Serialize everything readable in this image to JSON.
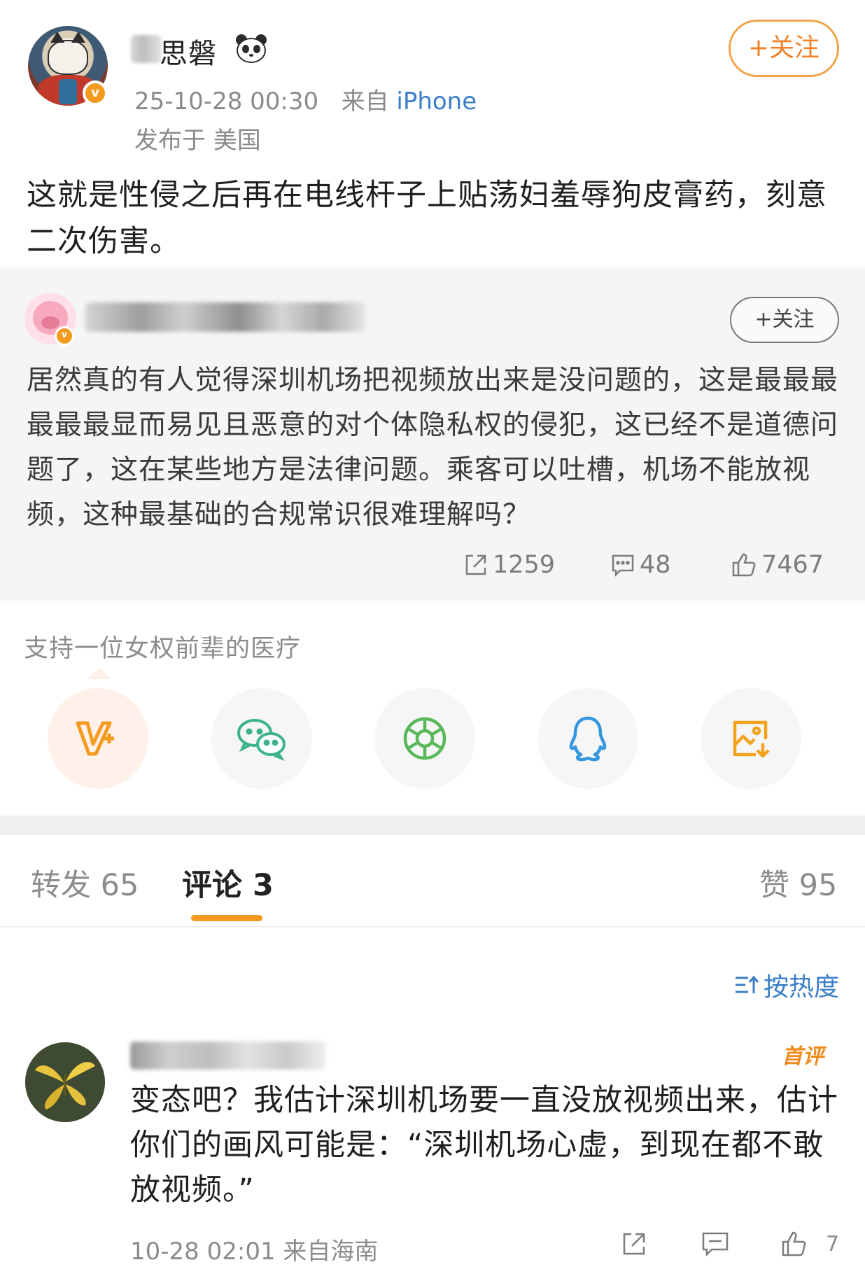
{
  "post": {
    "author_name": "思磐",
    "timestamp": "25-10-28 00:30",
    "source_prefix": "来自",
    "device": "iPhone",
    "location": "发布于 美国",
    "follow_label": "+关注",
    "text": "这就是性侵之后再在电线杆子上贴荡妇羞辱狗皮膏药，刻意二次伤害。"
  },
  "quoted": {
    "follow_label": "+关注",
    "text": "居然真的有人觉得深圳机场把视频放出来是没问题的，这是最最最最最最显而易见且恶意的对个体隐私权的侵犯，这已经不是道德问题了，这在某些地方是法律问题。乘客可以吐槽，机场不能放视频，这种最基础的合规常识很难理解吗？",
    "reposts": "1259",
    "comments": "48",
    "likes": "7467"
  },
  "share": {
    "title": "支持一位女权前辈的医疗",
    "items": [
      {
        "icon": "vip-icon"
      },
      {
        "icon": "wechat-icon"
      },
      {
        "icon": "moments-icon"
      },
      {
        "icon": "qq-icon"
      },
      {
        "icon": "save-image-icon"
      }
    ]
  },
  "tabs": {
    "repost": "转发 65",
    "comment": "评论 3",
    "like": "赞 95",
    "active": "comment"
  },
  "sort": {
    "label": "按热度"
  },
  "comment": {
    "badge": "首评",
    "text": "变态吧？我估计深圳机场要一直没放视频出来，估计你们的画风可能是：“深圳机场心虚，到现在都不敢放视频。”",
    "meta": "10-28 02:01 来自海南",
    "likes": "7"
  },
  "colors": {
    "accent_orange": "#f39b1f",
    "link_blue": "#3a7fc8",
    "quote_bg": "#f5f5f5"
  }
}
